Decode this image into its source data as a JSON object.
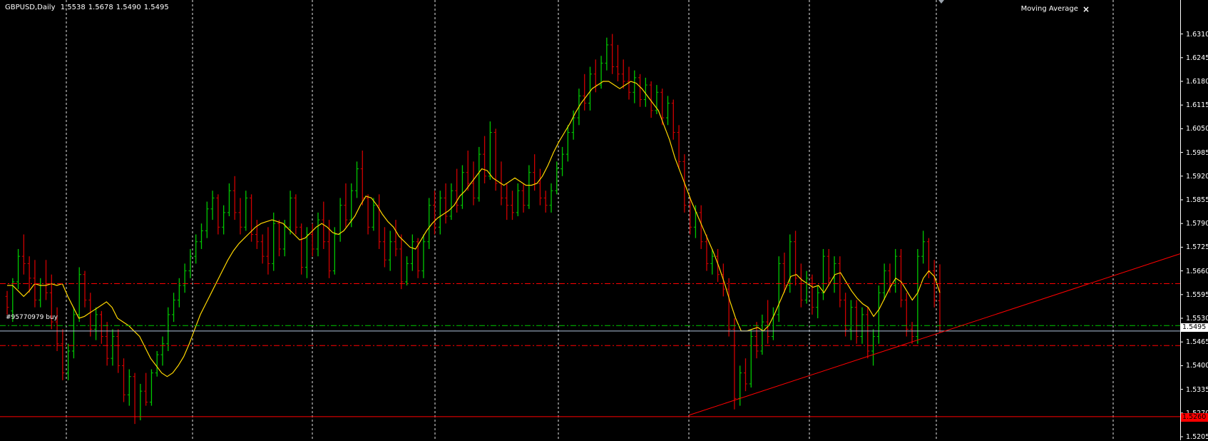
{
  "header": {
    "symbol": "GBPUSD,Daily",
    "open": "1.5538",
    "high": "1.5678",
    "low": "1.5490",
    "close": "1.5495"
  },
  "indicator": {
    "name": "Moving Average",
    "close_label": "×"
  },
  "order": {
    "label": "#95770979 buy"
  },
  "price_axis": {
    "ticks": [
      "1.6310",
      "1.6245",
      "1.6180",
      "1.6115",
      "1.6050",
      "1.5985",
      "1.5920",
      "1.5855",
      "1.5790",
      "1.5725",
      "1.5660",
      "1.5595",
      "1.5530",
      "1.5465",
      "1.5400",
      "1.5335",
      "1.5270",
      "1.5205"
    ],
    "current_price": "1.5495",
    "level_price": "1.5260"
  },
  "colors": {
    "background": "#000000",
    "bull_bar": "#00c800",
    "bear_bar": "#d00000",
    "ma_line": "#ffd700",
    "grid": "#ffffff",
    "bid_line": "#b0c4de",
    "order_line": "#00c800",
    "level_line": "#ff0000",
    "trendline": "#ff0000"
  },
  "chart_data": {
    "type": "line",
    "title": "",
    "ylim": [
      1.5205,
      1.6335
    ],
    "grid": true,
    "y_step": 0.0065,
    "current_price": 1.5495,
    "horizontal_levels": [
      {
        "name": "upper-dashed",
        "value": 1.5625,
        "style": "dashdot",
        "color": "#ff0000"
      },
      {
        "name": "order-buy",
        "value": 1.551,
        "style": "dashdot",
        "color": "#00c800"
      },
      {
        "name": "lower-dashed",
        "value": 1.5455,
        "style": "dashdot",
        "color": "#ff0000"
      },
      {
        "name": "solid-level",
        "value": 1.526,
        "style": "solid",
        "color": "#ff0000"
      }
    ],
    "trendline": {
      "from": [
        0,
        1.5264
      ],
      "to": [
        0,
        1.5707
      ]
    },
    "moving_average": [
      1.562,
      1.562,
      1.5605,
      1.559,
      1.5605,
      1.5625,
      1.562,
      1.562,
      1.5625,
      1.562,
      1.5625,
      1.559,
      1.556,
      1.553,
      1.5535,
      1.5545,
      1.5555,
      1.5565,
      1.5575,
      1.556,
      1.553,
      1.552,
      1.551,
      1.5495,
      1.548,
      1.545,
      1.542,
      1.54,
      1.538,
      1.537,
      1.538,
      1.54,
      1.5425,
      1.546,
      1.55,
      1.554,
      1.557,
      1.56,
      1.563,
      1.566,
      1.569,
      1.5715,
      1.5735,
      1.575,
      1.5765,
      1.578,
      1.579,
      1.5795,
      1.58,
      1.5795,
      1.579,
      1.5775,
      1.576,
      1.5745,
      1.575,
      1.5765,
      1.578,
      1.579,
      1.578,
      1.5765,
      1.576,
      1.577,
      1.579,
      1.581,
      1.584,
      1.5865,
      1.586,
      1.584,
      1.5815,
      1.5795,
      1.578,
      1.5755,
      1.574,
      1.5725,
      1.572,
      1.5745,
      1.577,
      1.579,
      1.5805,
      1.5815,
      1.5825,
      1.584,
      1.5865,
      1.588,
      1.59,
      1.592,
      1.594,
      1.5935,
      1.5915,
      1.5905,
      1.5895,
      1.5905,
      1.5915,
      1.5905,
      1.5895,
      1.5895,
      1.59,
      1.592,
      1.595,
      1.5985,
      1.6015,
      1.604,
      1.6065,
      1.6095,
      1.612,
      1.614,
      1.616,
      1.617,
      1.618,
      1.618,
      1.617,
      1.616,
      1.617,
      1.618,
      1.6175,
      1.616,
      1.614,
      1.612,
      1.61,
      1.606,
      1.602,
      1.597,
      1.593,
      1.589,
      1.585,
      1.5815,
      1.578,
      1.5745,
      1.571,
      1.567,
      1.5625,
      1.5575,
      1.553,
      1.5495,
      1.5495,
      1.55,
      1.5505,
      1.5495,
      1.551,
      1.554,
      1.5575,
      1.561,
      1.5645,
      1.565,
      1.5635,
      1.5625,
      1.5615,
      1.562,
      1.56,
      1.5625,
      1.565,
      1.5655,
      1.563,
      1.5605,
      1.5585,
      1.557,
      1.556,
      1.5535,
      1.5555,
      1.5585,
      1.5615,
      1.564,
      1.563,
      1.5605,
      1.558,
      1.56,
      1.564,
      1.566,
      1.5645,
      1.56
    ],
    "candles": [
      [
        1.559,
        1.5605,
        1.554,
        1.556
      ],
      [
        1.555,
        1.564,
        1.552,
        1.563
      ],
      [
        1.563,
        1.572,
        1.561,
        1.57
      ],
      [
        1.57,
        1.576,
        1.565,
        1.568
      ],
      [
        1.568,
        1.57,
        1.56,
        1.564
      ],
      [
        1.564,
        1.569,
        1.556,
        1.558
      ],
      [
        1.558,
        1.564,
        1.556,
        1.562
      ],
      [
        1.562,
        1.569,
        1.558,
        1.56
      ],
      [
        1.56,
        1.565,
        1.55,
        1.552
      ],
      [
        1.552,
        1.556,
        1.544,
        1.546
      ],
      [
        1.546,
        1.55,
        1.536,
        1.538
      ],
      [
        1.538,
        1.546,
        1.536,
        1.544
      ],
      [
        1.544,
        1.556,
        1.542,
        1.554
      ],
      [
        1.554,
        1.567,
        1.552,
        1.565
      ],
      [
        1.565,
        1.566,
        1.556,
        1.558
      ],
      [
        1.558,
        1.56,
        1.548,
        1.55
      ],
      [
        1.55,
        1.556,
        1.547,
        1.554
      ],
      [
        1.554,
        1.555,
        1.546,
        1.548
      ],
      [
        1.548,
        1.552,
        1.54,
        1.542
      ],
      [
        1.542,
        1.55,
        1.54,
        1.548
      ],
      [
        1.548,
        1.55,
        1.538,
        1.54
      ],
      [
        1.54,
        1.542,
        1.53,
        1.532
      ],
      [
        1.532,
        1.539,
        1.529,
        1.537
      ],
      [
        1.537,
        1.538,
        1.524,
        1.526
      ],
      [
        1.526,
        1.535,
        1.525,
        1.533
      ],
      [
        1.533,
        1.538,
        1.529,
        1.53
      ],
      [
        1.53,
        1.539,
        1.529,
        1.538
      ],
      [
        1.538,
        1.544,
        1.537,
        1.543
      ],
      [
        1.543,
        1.548,
        1.54,
        1.546
      ],
      [
        1.546,
        1.556,
        1.544,
        1.554
      ],
      [
        1.554,
        1.56,
        1.552,
        1.558
      ],
      [
        1.558,
        1.564,
        1.556,
        1.562
      ],
      [
        1.562,
        1.568,
        1.56,
        1.566
      ],
      [
        1.566,
        1.572,
        1.564,
        1.57
      ],
      [
        1.57,
        1.576,
        1.568,
        1.574
      ],
      [
        1.574,
        1.579,
        1.572,
        1.577
      ],
      [
        1.577,
        1.585,
        1.575,
        1.583
      ],
      [
        1.583,
        1.588,
        1.58,
        1.586
      ],
      [
        1.586,
        1.587,
        1.576,
        1.578
      ],
      [
        1.578,
        1.584,
        1.576,
        1.582
      ],
      [
        1.582,
        1.59,
        1.581,
        1.588
      ],
      [
        1.588,
        1.592,
        1.58,
        1.582
      ],
      [
        1.582,
        1.586,
        1.576,
        1.578
      ],
      [
        1.578,
        1.588,
        1.577,
        1.586
      ],
      [
        1.586,
        1.587,
        1.574,
        1.576
      ],
      [
        1.576,
        1.58,
        1.572,
        1.574
      ],
      [
        1.574,
        1.576,
        1.568,
        1.57
      ],
      [
        1.57,
        1.578,
        1.565,
        1.568
      ],
      [
        1.568,
        1.582,
        1.566,
        1.579
      ],
      [
        1.579,
        1.58,
        1.57,
        1.572
      ],
      [
        1.572,
        1.58,
        1.57,
        1.578
      ],
      [
        1.578,
        1.588,
        1.576,
        1.586
      ],
      [
        1.586,
        1.587,
        1.576,
        1.578
      ],
      [
        1.578,
        1.579,
        1.565,
        1.567
      ],
      [
        1.567,
        1.578,
        1.564,
        1.576
      ],
      [
        1.576,
        1.579,
        1.57,
        1.572
      ],
      [
        1.572,
        1.582,
        1.57,
        1.58
      ],
      [
        1.58,
        1.585,
        1.572,
        1.574
      ],
      [
        1.574,
        1.58,
        1.564,
        1.566
      ],
      [
        1.566,
        1.578,
        1.565,
        1.576
      ],
      [
        1.576,
        1.586,
        1.574,
        1.584
      ],
      [
        1.584,
        1.59,
        1.578,
        1.58
      ],
      [
        1.58,
        1.59,
        1.578,
        1.588
      ],
      [
        1.588,
        1.596,
        1.586,
        1.594
      ],
      [
        1.594,
        1.599,
        1.584,
        1.586
      ],
      [
        1.586,
        1.587,
        1.576,
        1.578
      ],
      [
        1.578,
        1.586,
        1.577,
        1.584
      ],
      [
        1.584,
        1.587,
        1.572,
        1.574
      ],
      [
        1.574,
        1.578,
        1.567,
        1.569
      ],
      [
        1.569,
        1.577,
        1.566,
        1.574
      ],
      [
        1.574,
        1.58,
        1.57,
        1.572
      ],
      [
        1.572,
        1.576,
        1.561,
        1.563
      ],
      [
        1.563,
        1.57,
        1.562,
        1.568
      ],
      [
        1.568,
        1.576,
        1.566,
        1.574
      ],
      [
        1.574,
        1.575,
        1.564,
        1.566
      ],
      [
        1.566,
        1.576,
        1.564,
        1.574
      ],
      [
        1.574,
        1.586,
        1.572,
        1.584
      ],
      [
        1.584,
        1.588,
        1.576,
        1.578
      ],
      [
        1.578,
        1.588,
        1.576,
        1.586
      ],
      [
        1.586,
        1.59,
        1.579,
        1.581
      ],
      [
        1.581,
        1.59,
        1.58,
        1.588
      ],
      [
        1.588,
        1.594,
        1.582,
        1.584
      ],
      [
        1.584,
        1.595,
        1.583,
        1.593
      ],
      [
        1.593,
        1.599,
        1.588,
        1.59
      ],
      [
        1.59,
        1.596,
        1.584,
        1.586
      ],
      [
        1.586,
        1.6,
        1.585,
        1.598
      ],
      [
        1.598,
        1.603,
        1.59,
        1.592
      ],
      [
        1.592,
        1.607,
        1.591,
        1.604
      ],
      [
        1.604,
        1.605,
        1.588,
        1.59
      ],
      [
        1.59,
        1.596,
        1.584,
        1.586
      ],
      [
        1.586,
        1.59,
        1.58,
        1.584
      ],
      [
        1.584,
        1.588,
        1.58,
        1.582
      ],
      [
        1.582,
        1.59,
        1.581,
        1.588
      ],
      [
        1.588,
        1.59,
        1.582,
        1.584
      ],
      [
        1.584,
        1.595,
        1.583,
        1.593
      ],
      [
        1.593,
        1.598,
        1.588,
        1.59
      ],
      [
        1.59,
        1.594,
        1.584,
        1.586
      ],
      [
        1.586,
        1.588,
        1.582,
        1.584
      ],
      [
        1.584,
        1.59,
        1.582,
        1.588
      ],
      [
        1.588,
        1.596,
        1.587,
        1.594
      ],
      [
        1.594,
        1.6,
        1.592,
        1.598
      ],
      [
        1.598,
        1.606,
        1.596,
        1.604
      ],
      [
        1.604,
        1.61,
        1.602,
        1.608
      ],
      [
        1.608,
        1.616,
        1.606,
        1.614
      ],
      [
        1.614,
        1.62,
        1.61,
        1.612
      ],
      [
        1.612,
        1.622,
        1.61,
        1.62
      ],
      [
        1.62,
        1.624,
        1.615,
        1.617
      ],
      [
        1.617,
        1.625,
        1.616,
        1.623
      ],
      [
        1.623,
        1.63,
        1.621,
        1.628
      ],
      [
        1.628,
        1.631,
        1.62,
        1.622
      ],
      [
        1.622,
        1.628,
        1.618,
        1.62
      ],
      [
        1.62,
        1.624,
        1.616,
        1.618
      ],
      [
        1.618,
        1.622,
        1.613,
        1.615
      ],
      [
        1.615,
        1.621,
        1.612,
        1.619
      ],
      [
        1.619,
        1.62,
        1.611,
        1.613
      ],
      [
        1.613,
        1.619,
        1.611,
        1.617
      ],
      [
        1.617,
        1.618,
        1.608,
        1.61
      ],
      [
        1.61,
        1.617,
        1.609,
        1.615
      ],
      [
        1.615,
        1.616,
        1.606,
        1.608
      ],
      [
        1.608,
        1.614,
        1.606,
        1.612
      ],
      [
        1.612,
        1.613,
        1.602,
        1.604
      ],
      [
        1.604,
        1.606,
        1.594,
        1.596
      ],
      [
        1.596,
        1.598,
        1.582,
        1.584
      ],
      [
        1.584,
        1.586,
        1.576,
        1.578
      ],
      [
        1.578,
        1.584,
        1.575,
        1.582
      ],
      [
        1.582,
        1.584,
        1.572,
        1.574
      ],
      [
        1.574,
        1.576,
        1.566,
        1.568
      ],
      [
        1.568,
        1.572,
        1.565,
        1.57
      ],
      [
        1.57,
        1.572,
        1.563,
        1.565
      ],
      [
        1.565,
        1.568,
        1.559,
        1.561
      ],
      [
        1.561,
        1.564,
        1.548,
        1.55
      ],
      [
        1.55,
        1.553,
        1.528,
        1.531
      ],
      [
        1.531,
        1.54,
        1.529,
        1.538
      ],
      [
        1.538,
        1.542,
        1.533,
        1.535
      ],
      [
        1.535,
        1.55,
        1.534,
        1.548
      ],
      [
        1.548,
        1.552,
        1.542,
        1.544
      ],
      [
        1.544,
        1.554,
        1.543,
        1.552
      ],
      [
        1.552,
        1.558,
        1.546,
        1.548
      ],
      [
        1.548,
        1.556,
        1.547,
        1.554
      ],
      [
        1.554,
        1.57,
        1.552,
        1.568
      ],
      [
        1.568,
        1.571,
        1.56,
        1.562
      ],
      [
        1.562,
        1.576,
        1.56,
        1.574
      ],
      [
        1.574,
        1.577,
        1.562,
        1.564
      ],
      [
        1.564,
        1.568,
        1.556,
        1.558
      ],
      [
        1.558,
        1.566,
        1.557,
        1.564
      ],
      [
        1.564,
        1.565,
        1.554,
        1.556
      ],
      [
        1.556,
        1.562,
        1.553,
        1.56
      ],
      [
        1.56,
        1.572,
        1.558,
        1.57
      ],
      [
        1.57,
        1.572,
        1.562,
        1.564
      ],
      [
        1.564,
        1.57,
        1.56,
        1.568
      ],
      [
        1.568,
        1.57,
        1.556,
        1.558
      ],
      [
        1.558,
        1.56,
        1.548,
        1.55
      ],
      [
        1.55,
        1.558,
        1.547,
        1.556
      ],
      [
        1.556,
        1.558,
        1.546,
        1.548
      ],
      [
        1.548,
        1.556,
        1.546,
        1.554
      ],
      [
        1.554,
        1.556,
        1.542,
        1.544
      ],
      [
        1.544,
        1.55,
        1.54,
        1.548
      ],
      [
        1.548,
        1.562,
        1.546,
        1.56
      ],
      [
        1.56,
        1.568,
        1.558,
        1.566
      ],
      [
        1.566,
        1.568,
        1.56,
        1.562
      ],
      [
        1.562,
        1.572,
        1.56,
        1.57
      ],
      [
        1.57,
        1.572,
        1.556,
        1.558
      ],
      [
        1.558,
        1.56,
        1.548,
        1.55
      ],
      [
        1.55,
        1.552,
        1.546,
        1.548
      ],
      [
        1.548,
        1.572,
        1.546,
        1.57
      ],
      [
        1.57,
        1.577,
        1.568,
        1.574
      ],
      [
        1.574,
        1.575,
        1.564,
        1.566
      ],
      [
        1.566,
        1.569,
        1.556,
        1.558
      ],
      [
        1.5578,
        1.5678,
        1.549,
        1.5495
      ]
    ]
  }
}
